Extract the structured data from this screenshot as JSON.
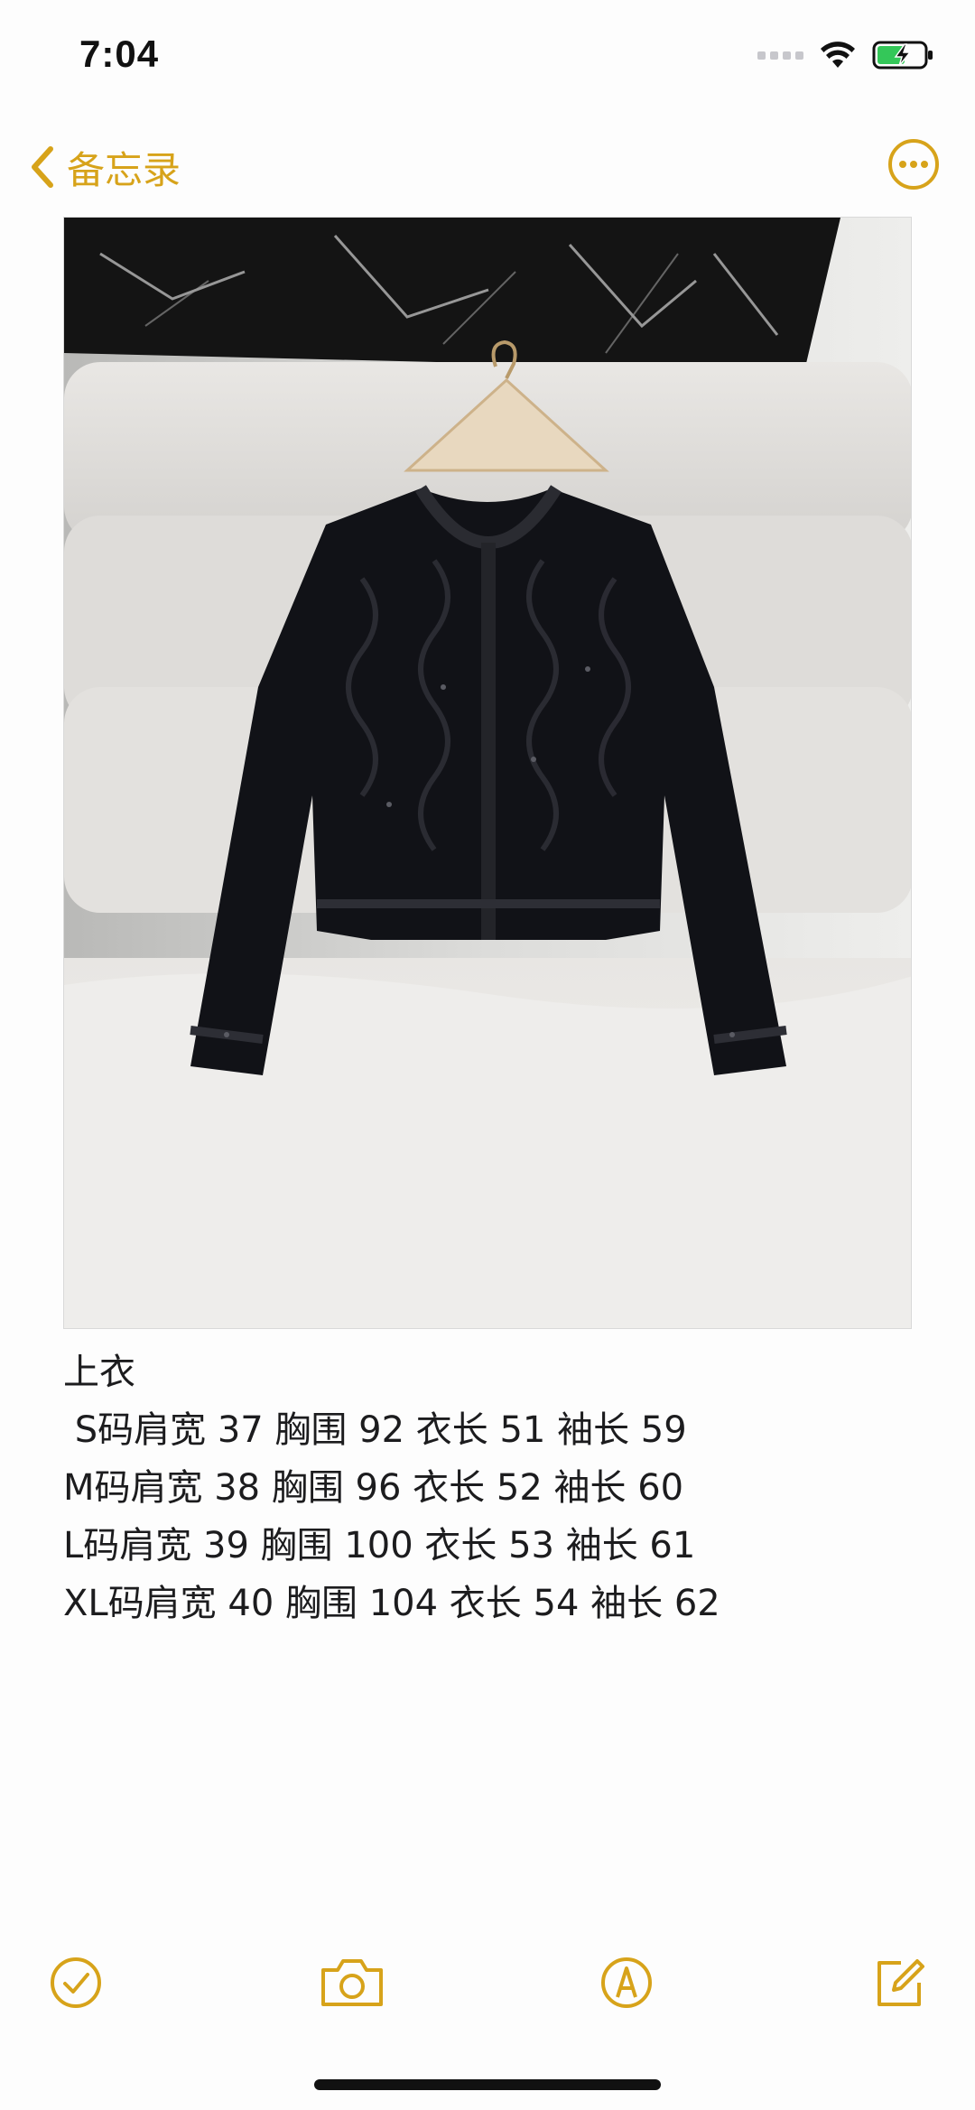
{
  "status_bar": {
    "time": "7:04"
  },
  "nav": {
    "back_label": "备忘录",
    "more_icon": "ellipsis-circle-icon"
  },
  "note": {
    "title": "上衣",
    "size_lines": [
      " S码肩宽 37 胸围 92 衣长 51 袖长 59",
      "M码肩宽 38 胸围 96 衣长 52 袖长 60",
      "L码肩宽 39 胸围 100 衣长 53 袖长 61",
      "XL码肩宽 40 胸围 104 衣长 54 袖长 62"
    ]
  },
  "toolbar": {
    "icons": [
      "checklist-icon",
      "camera-icon",
      "markup-pen-icon",
      "compose-icon"
    ]
  },
  "colors": {
    "accent": "#d7a31a",
    "text": "#1c1c1e",
    "battery": "#34c759"
  }
}
